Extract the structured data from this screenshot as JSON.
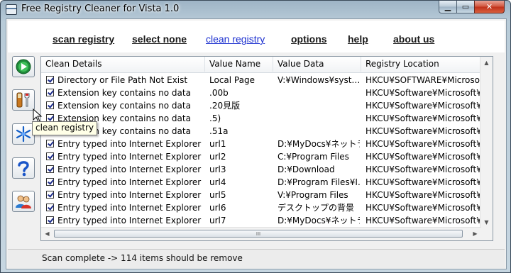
{
  "window": {
    "title": "Free Registry Cleaner for Vista 1.0"
  },
  "titlebar": {
    "min_glyph": "▁",
    "max_glyph": "▭",
    "close_glyph": "✕"
  },
  "menu": {
    "items": [
      {
        "label": "scan registry"
      },
      {
        "label": "select none"
      },
      {
        "label": "clean registry"
      },
      {
        "label": "options"
      },
      {
        "label": "help"
      },
      {
        "label": "about us"
      }
    ],
    "active": "clean registry"
  },
  "sidebar": {
    "buttons": [
      {
        "icon": "play-icon"
      },
      {
        "icon": "tools-icon"
      },
      {
        "icon": "snowflake-icon"
      },
      {
        "icon": "help-icon"
      },
      {
        "icon": "users-icon"
      }
    ]
  },
  "tooltip": {
    "text": "clean registry"
  },
  "grid": {
    "columns": [
      "Clean Details",
      "Value Name",
      "Value Data",
      "Registry Location"
    ],
    "rows": [
      {
        "detail": "Directory or File Path Not Exist",
        "name": "Local Page",
        "data": "V:¥Windows¥syst…",
        "location": "HKCU¥SOFTWARE¥Microsoft¥I"
      },
      {
        "detail": "Extension key contains no data",
        "name": ".00b",
        "data": "",
        "location": "HKCU¥Software¥Microsoft¥Wir"
      },
      {
        "detail": "Extension key contains no data",
        "name": ".20見版",
        "data": "",
        "location": "HKCU¥Software¥Microsoft¥Wir"
      },
      {
        "detail": "Extension key contains no data",
        "name": ".5)",
        "data": "",
        "location": "HKCU¥Software¥Microsoft¥Wir"
      },
      {
        "detail": "Extension key contains no data",
        "name": ".51a",
        "data": "",
        "location": "HKCU¥Software¥Microsoft¥Wir"
      },
      {
        "detail": "Entry typed into Internet Explorer",
        "name": "url1",
        "data": "D:¥MyDocs¥ネットラ…",
        "location": "HKCU¥Software¥Microsoft¥Inte"
      },
      {
        "detail": "Entry typed into Internet Explorer",
        "name": "url2",
        "data": "C:¥Program Files",
        "location": "HKCU¥Software¥Microsoft¥Inte"
      },
      {
        "detail": "Entry typed into Internet Explorer",
        "name": "url3",
        "data": "D:¥Download",
        "location": "HKCU¥Software¥Microsoft¥Inte"
      },
      {
        "detail": "Entry typed into Internet Explorer",
        "name": "url4",
        "data": "D:¥Program Files¥I…",
        "location": "HKCU¥Software¥Microsoft¥Inte"
      },
      {
        "detail": "Entry typed into Internet Explorer",
        "name": "url5",
        "data": "V:¥Program Files",
        "location": "HKCU¥Software¥Microsoft¥Inte"
      },
      {
        "detail": "Entry typed into Internet Explorer",
        "name": "url6",
        "data": "デスクトップの背景",
        "location": "HKCU¥Software¥Microsoft¥Inte"
      },
      {
        "detail": "Entry typed into Internet Explorer",
        "name": "url7",
        "data": "D:¥MyDocs¥ネットラ…",
        "location": "HKCU¥Software¥Microsoft¥Inte"
      }
    ],
    "scroll_up": "▲",
    "scroll_down": "▼",
    "scroll_left": "◀",
    "scroll_right": "▶",
    "hthumb_grip": "III"
  },
  "status": {
    "text": "Scan complete -> 114 items should be remove"
  }
}
